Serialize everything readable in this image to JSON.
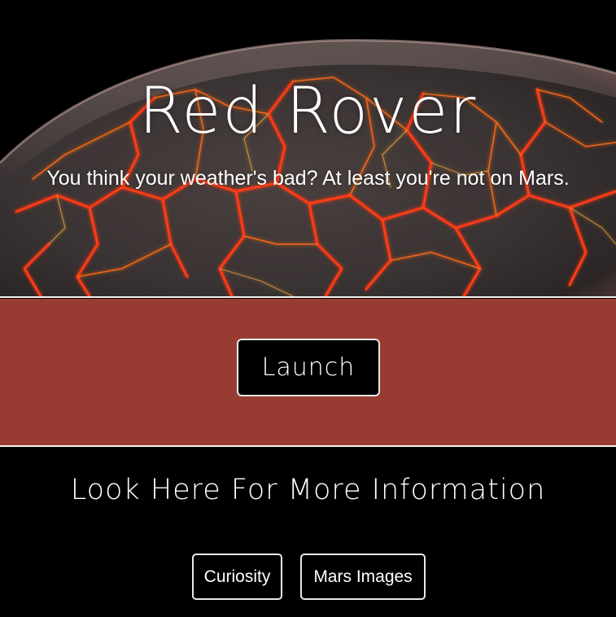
{
  "hero": {
    "title": "Red Rover",
    "subtitle": "You think your weather's bad? At least you're not on Mars.",
    "planet_image": "lava-planet-image"
  },
  "launch": {
    "button_label": "Launch"
  },
  "info": {
    "heading": "Look Here For More Information",
    "links": [
      {
        "label": "Curiosity"
      },
      {
        "label": "Mars Images"
      }
    ]
  },
  "colors": {
    "band": "#983c33",
    "background": "#000000",
    "lava": "#ff3a14",
    "rock": "#3a3232"
  }
}
